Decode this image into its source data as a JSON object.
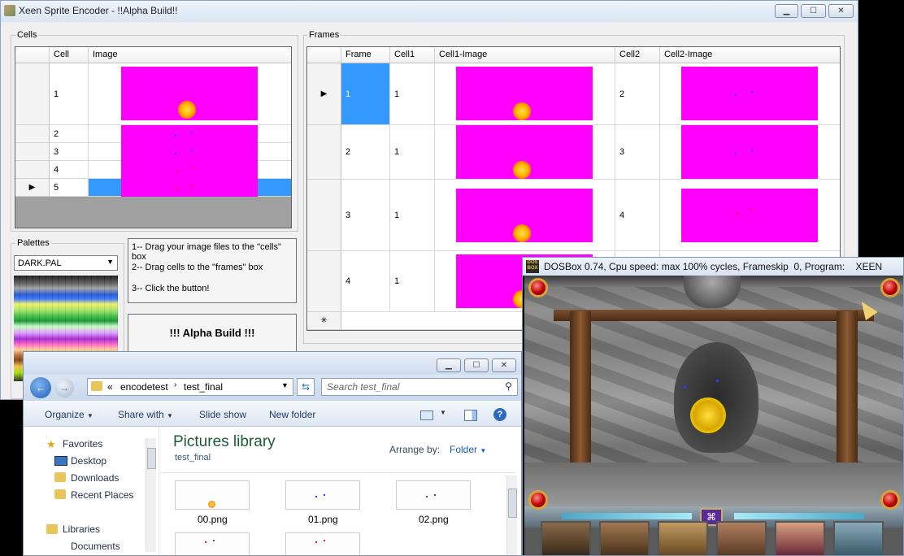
{
  "main": {
    "title": "Xeen Sprite Encoder - !!Alpha Build!!",
    "cells_group": "Cells",
    "frames_group": "Frames",
    "palettes_group": "Palettes",
    "cells_columns": [
      "Cell",
      "Image"
    ],
    "cells_rows": [
      "1",
      "2",
      "3",
      "4",
      "5"
    ],
    "frames_columns": [
      "Frame",
      "Cell1",
      "Cell1-Image",
      "Cell2",
      "Cell2-Image"
    ],
    "frames_rows": [
      {
        "frame": "1",
        "cell1": "1",
        "cell2": "2"
      },
      {
        "frame": "2",
        "cell1": "1",
        "cell2": "3"
      },
      {
        "frame": "3",
        "cell1": "1",
        "cell2": "4"
      },
      {
        "frame": "4",
        "cell1": "1",
        "cell2": ""
      }
    ],
    "new_row_marker": "✳",
    "row_pointer": "▶",
    "palette_selected": "DARK.PAL",
    "instructions": [
      "1-- Drag your image files to the \"cells\" box",
      "2-- Drag cells to the \"frames\" box",
      "3-- Click the button!"
    ],
    "alpha_button": "!!! Alpha Build !!!"
  },
  "explorer": {
    "breadcrumb_prefix": "«",
    "path": [
      "encodetest",
      "test_final"
    ],
    "search_placeholder": "Search test_final",
    "commands": [
      "Organize",
      "Share with",
      "Slide show",
      "New folder"
    ],
    "nav": {
      "favorites": "Favorites",
      "items": [
        "Desktop",
        "Downloads",
        "Recent Places"
      ],
      "libraries": "Libraries",
      "libraries_items": [
        "Documents"
      ]
    },
    "library_title": "Pictures library",
    "library_sub": "test_final",
    "arrange_label": "Arrange by:",
    "arrange_value": "Folder",
    "files": [
      "00.png",
      "01.png",
      "02.png"
    ]
  },
  "dosbox": {
    "icon_text": "DOS BOX",
    "title": "DOSBox 0.74, Cpu speed: max 100% cycles, Frameskip  0, Program:    XEEN"
  },
  "colors": {
    "accent": "#3399ff",
    "magenta": "#ff00ff"
  }
}
